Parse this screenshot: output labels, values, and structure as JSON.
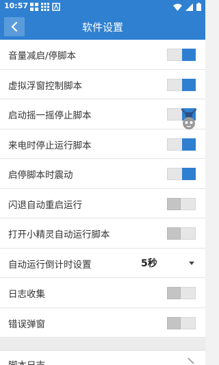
{
  "status": {
    "time": "10:57"
  },
  "header": {
    "title": "软件设置"
  },
  "settings": [
    {
      "label": "音量减启/停脚本",
      "on": true
    },
    {
      "label": "虚拟浮窗控制脚本",
      "on": true
    },
    {
      "label": "启动摇一摇停止脚本",
      "on": true
    },
    {
      "label": "来电时停止运行脚本",
      "on": true
    },
    {
      "label": "启停脚本时震动",
      "on": true
    },
    {
      "label": "闪退自动重启运行",
      "on": false
    },
    {
      "label": "打开小精灵自动运行脚本",
      "on": false
    }
  ],
  "countdown": {
    "label": "自动运行倒计时设置",
    "value": "5秒"
  },
  "settings2": [
    {
      "label": "日志收集",
      "on": false
    },
    {
      "label": "错误弹窗",
      "on": false
    }
  ],
  "footer": {
    "script_log_label": "脚本日志"
  },
  "colors": {
    "primary": "#2f80d1",
    "switch_on": "#2f7fd0",
    "switch_off": "#c4c4c4"
  }
}
